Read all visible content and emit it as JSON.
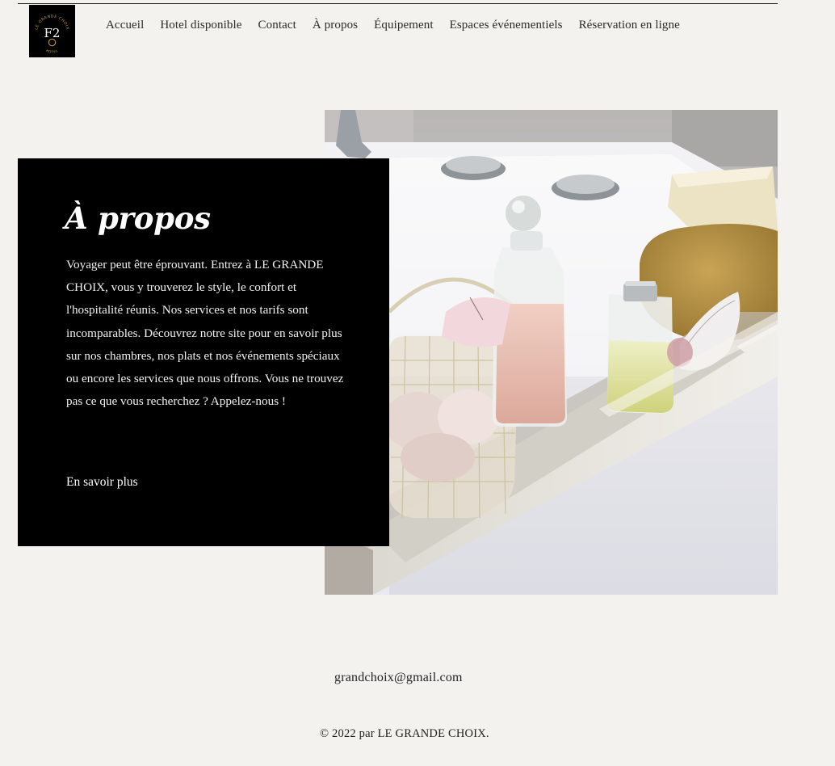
{
  "brand": {
    "logo_ring_text_top": "LE GRANDE CHOIX",
    "logo_monogram": "F2",
    "logo_ring_text_bottom": "HOTEL",
    "logo_bg": "#000000",
    "logo_accent": "#c9a24a"
  },
  "nav": {
    "items": [
      {
        "label": "Accueil"
      },
      {
        "label": "Hotel disponible"
      },
      {
        "label": "Contact"
      },
      {
        "label": "À propos"
      },
      {
        "label": "Équipement"
      },
      {
        "label": "Espaces événementiels"
      },
      {
        "label": "Réservation en ligne"
      }
    ]
  },
  "about": {
    "title": "À propos",
    "body": "Voyager peut être éprouvant. Entrez à LE GRANDE CHOIX, vous y trouverez le style, le confort et l'hospitalité réunis. Nos services et nos tarifs sont incomparables. Découvrez notre site pour en savoir plus sur nos chambres, nos plats et nos événements spéciaux ou encore les services que nous offrons. Vous ne trouvez pas ce que vous recherchez ? Appelez-nous !",
    "link_label": "En savoir plus"
  },
  "hero_image": {
    "icon": "bath-spa-photo"
  },
  "footer": {
    "email": "grandchoix@gmail.com",
    "copyright": "© 2022 par LE GRANDE CHOIX."
  },
  "colors": {
    "page_bg": "#f4f2ee",
    "panel_bg": "#000000",
    "text": "#1a1a1a"
  }
}
